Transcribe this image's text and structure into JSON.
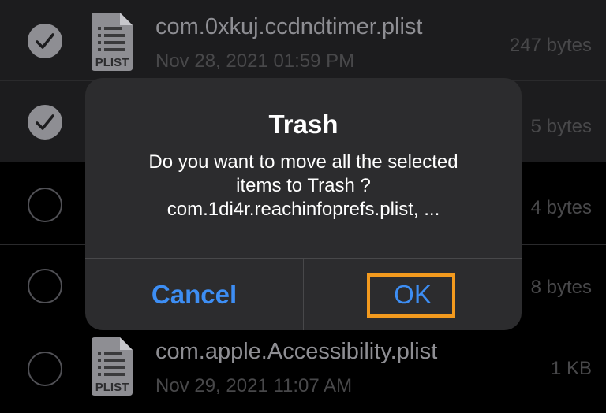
{
  "files": [
    {
      "name": "com.0xkuj.ccdndtimer.plist",
      "date": "Nov 28, 2021 01:59 PM",
      "size": "247 bytes",
      "selected": true,
      "icon": "plist-file-icon",
      "icon_label": "PLIST"
    },
    {
      "name": "",
      "date": "",
      "size": "5 bytes",
      "selected": true
    },
    {
      "name": "",
      "date": "",
      "size": "4 bytes",
      "selected": false
    },
    {
      "name": "",
      "date": "",
      "size": "8 bytes",
      "selected": false
    },
    {
      "name": "com.apple.Accessibility.plist",
      "date": "Nov 29, 2021 11:07 AM",
      "size": "1 KB",
      "selected": false,
      "icon": "plist-file-icon",
      "icon_label": "PLIST"
    }
  ],
  "alert": {
    "title": "Trash",
    "message_lines": [
      "Do you want to move all the selected",
      "items to Trash ?",
      "com.1di4r.reachinfoprefs.plist, ..."
    ],
    "cancel_label": "Cancel",
    "ok_label": "OK"
  },
  "colors": {
    "accent": "#3d8ef4",
    "highlight": "#f39a1e",
    "alert_bg": "#2c2c2e"
  }
}
